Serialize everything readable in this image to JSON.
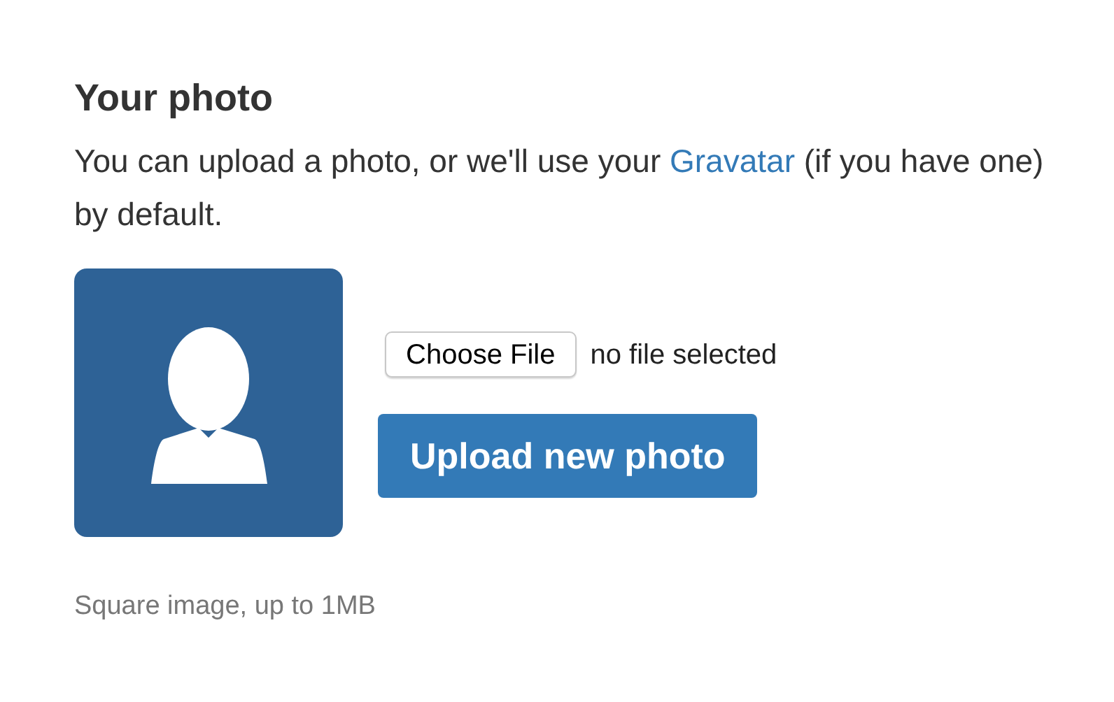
{
  "heading": "Your photo",
  "intro": {
    "before": "You can upload a photo, or we'll use your ",
    "link": "Gravatar",
    "after": " (if you have one) by default."
  },
  "avatar": {
    "kind": "placeholder"
  },
  "file_input": {
    "button": "Choose File",
    "status": "no file selected"
  },
  "upload_button": "Upload new photo",
  "hint": "Square image, up to 1MB"
}
